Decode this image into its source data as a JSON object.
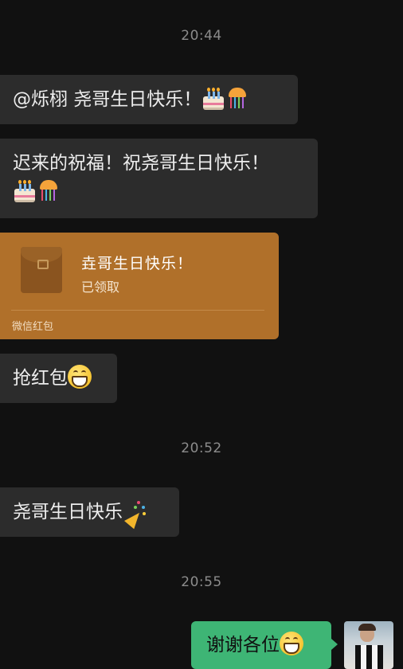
{
  "chat": {
    "timestamps": [
      "20:44",
      "20:52",
      "20:55"
    ],
    "messages": [
      {
        "text": "@烁栩  尧哥生日快乐！",
        "emojis": [
          "birthday-cake",
          "confetti-ball"
        ]
      },
      {
        "line1": "迟来的祝福！祝尧哥生日快乐！",
        "emojis": [
          "birthday-cake",
          "confetti-ball"
        ]
      },
      {
        "text": "抢红包",
        "emojis": [
          "grinning-face"
        ]
      },
      {
        "text": "尧哥生日快乐",
        "emojis": [
          "party-popper"
        ]
      }
    ],
    "red_packet": {
      "title": "垚哥生日快乐！",
      "status": "已领取",
      "footer": "微信红包"
    },
    "outgoing": {
      "text": "谢谢各位",
      "emojis": [
        "grinning-face"
      ]
    }
  },
  "colors": {
    "background": "#111111",
    "incoming_bubble": "#2c2c2c",
    "outgoing_bubble": "#3eb575",
    "red_packet": "#b0702a"
  }
}
